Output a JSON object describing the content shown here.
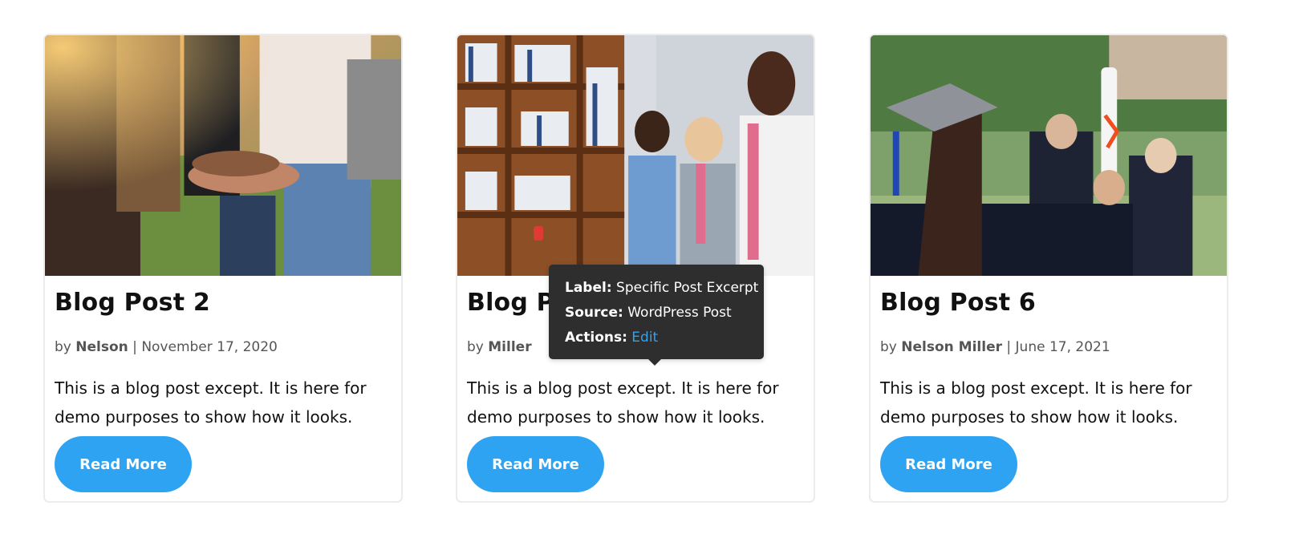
{
  "cards": [
    {
      "title": "Blog Post 2",
      "by": "by",
      "author": "Nelson",
      "separator": "|",
      "date": "November 17, 2020",
      "excerpt": "This is a blog post except. It is here for demo purposes to show how it looks.",
      "button_label": "Read More"
    },
    {
      "title": "Blog Post",
      "by": "by",
      "author": "Miller",
      "separator": "",
      "date": "",
      "excerpt": "This is a blog post except. It is here for demo purposes to show how it looks.",
      "button_label": "Read More"
    },
    {
      "title": "Blog Post 6",
      "by": "by",
      "author": "Nelson Miller",
      "separator": "|",
      "date": "June 17, 2021",
      "excerpt": "This is a blog post except. It is here for demo purposes to show how it looks.",
      "button_label": "Read More"
    }
  ],
  "tooltip": {
    "label_key": "Label:",
    "label_value": "Specific Post Excerpt",
    "source_key": "Source:",
    "source_value": "WordPress Post",
    "actions_key": "Actions:",
    "actions_value": "Edit"
  },
  "colors": {
    "accent": "#2ea3f2",
    "tooltip_bg": "#2e2e2e",
    "meta_text": "#555555"
  }
}
